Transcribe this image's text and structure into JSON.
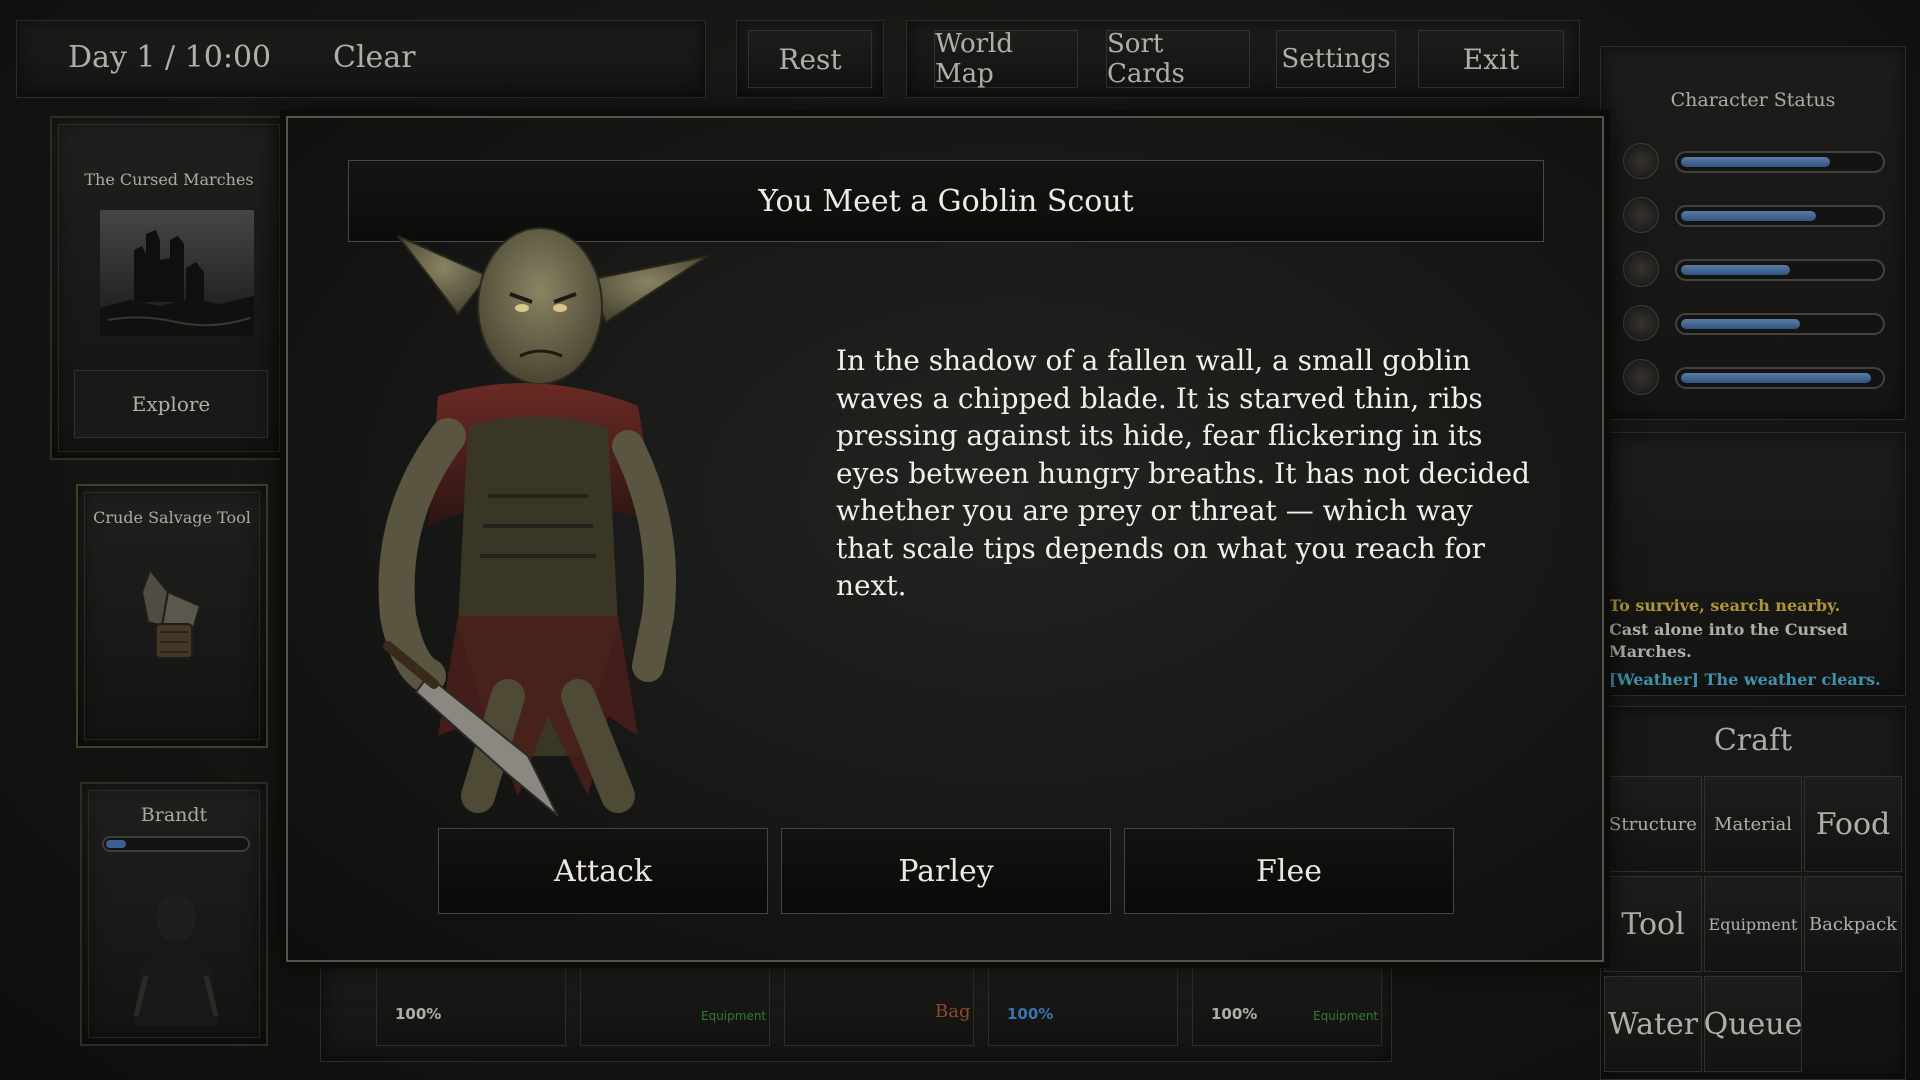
{
  "top_bar": {
    "day_time": "Day 1 / 10:00",
    "weather": "Clear",
    "rest_label": "Rest",
    "world_map_label": "World Map",
    "sort_cards_label": "Sort Cards",
    "settings_label": "Settings",
    "exit_label": "Exit"
  },
  "left_cards": {
    "location": {
      "title": "The Cursed Marches",
      "action_label": "Explore"
    },
    "tool": {
      "title": "Crude Salvage Tool"
    },
    "character": {
      "name": "Brandt",
      "bar_level": 0.14
    }
  },
  "modal": {
    "title": "You Meet a Goblin Scout",
    "text": "In the shadow of a fallen wall, a small goblin waves a chipped blade. It is starved thin, ribs pressing against its hide, fear flickering in its eyes between hungry breaths. It has not decided whether you are prey or threat — which way that scale tips depends on what you reach for next.",
    "choices": [
      {
        "label": "Attack"
      },
      {
        "label": "Parley"
      },
      {
        "label": "Flee"
      }
    ]
  },
  "character_status": {
    "title": "Character Status",
    "stats": [
      {
        "icon": "heart-icon",
        "level": 0.75
      },
      {
        "icon": "stomach-icon",
        "level": 0.68
      },
      {
        "icon": "water-drop-icon",
        "level": 0.55
      },
      {
        "icon": "head-icon",
        "level": 0.6
      },
      {
        "icon": "moon-icon",
        "level": 0.96
      }
    ],
    "colors": {
      "bar": "#5b8cc8"
    }
  },
  "log": {
    "lines": [
      {
        "text": "To survive, search nearby.",
        "color": "#e8c94a"
      },
      {
        "text": "Cast alone into the Cursed Marches.",
        "color": "#ece8de"
      },
      {
        "text": "[Weather] The weather clears.",
        "color": "#55c3e8"
      }
    ]
  },
  "craft": {
    "title": "Craft",
    "buttons": [
      "Structure",
      "Material",
      "Food",
      "Tool",
      "Equipment",
      "Backpack",
      "Water",
      "Queue"
    ]
  },
  "bottom_slots": [
    {
      "percent": "100%",
      "percent_color": "#ece8de",
      "tag": ""
    },
    {
      "percent": "",
      "percent_color": "#ece8de",
      "tag": "Equipment"
    },
    {
      "percent": "Bag",
      "percent_color": "#c0603a",
      "tag": ""
    },
    {
      "percent": "100%",
      "percent_color": "#4f9be8",
      "tag": ""
    },
    {
      "percent": "100%",
      "percent_color": "#ece8de",
      "tag": "Equipment"
    }
  ]
}
